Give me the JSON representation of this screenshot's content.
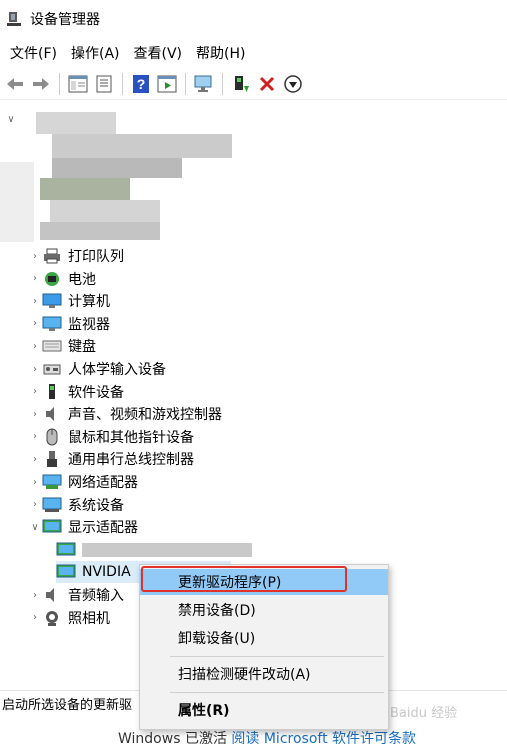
{
  "window": {
    "title": "设备管理器"
  },
  "menubar": {
    "items": [
      "文件(F)",
      "操作(A)",
      "查看(V)",
      "帮助(H)"
    ]
  },
  "toolbar": {
    "buttons": [
      "back-arrow-icon",
      "forward-arrow-icon",
      "view-tree-icon",
      "properties-sheet-icon",
      "help-icon",
      "run-icon",
      "monitor-scan-icon",
      "update-driver-icon",
      "uninstall-x-icon",
      "download-icon"
    ]
  },
  "tree": {
    "categories": [
      {
        "label": "打印队列",
        "icon": "printer-icon",
        "expanded": false
      },
      {
        "label": "电池",
        "icon": "battery-icon",
        "expanded": false
      },
      {
        "label": "计算机",
        "icon": "computer-icon",
        "expanded": false
      },
      {
        "label": "监视器",
        "icon": "monitor-icon",
        "expanded": false
      },
      {
        "label": "键盘",
        "icon": "keyboard-icon",
        "expanded": false
      },
      {
        "label": "人体学输入设备",
        "icon": "hid-icon",
        "expanded": false
      },
      {
        "label": "软件设备",
        "icon": "software-device-icon",
        "expanded": false
      },
      {
        "label": "声音、视频和游戏控制器",
        "icon": "speaker-icon",
        "expanded": false
      },
      {
        "label": "鼠标和其他指针设备",
        "icon": "mouse-icon",
        "expanded": false
      },
      {
        "label": "通用串行总线控制器",
        "icon": "usb-icon",
        "expanded": false
      },
      {
        "label": "网络适配器",
        "icon": "network-icon",
        "expanded": false
      },
      {
        "label": "系统设备",
        "icon": "system-device-icon",
        "expanded": false
      },
      {
        "label": "显示适配器",
        "icon": "display-adapter-icon",
        "expanded": true
      }
    ],
    "display_children": [
      "NVIDIA"
    ],
    "after": [
      {
        "label": "音频输入",
        "icon": "audio-input-icon"
      },
      {
        "label": "照相机",
        "icon": "camera-icon"
      }
    ]
  },
  "context_menu": {
    "items": [
      {
        "label": "更新驱动程序(P)",
        "highlighted": true,
        "bold": false
      },
      {
        "label": "禁用设备(D)",
        "highlighted": false,
        "bold": false
      },
      {
        "label": "卸载设备(U)",
        "highlighted": false,
        "bold": false
      },
      {
        "label": "扫描检测硬件改动(A)",
        "highlighted": false,
        "bold": false
      },
      {
        "label": "属性(R)",
        "highlighted": false,
        "bold": true
      }
    ],
    "highlight_border_color": "#e0322b",
    "highlight_fill_color": "#91c9f7"
  },
  "statusbar": {
    "text": "启动所选设备的更新驱"
  },
  "activation": {
    "prefix": "Windows 已激活",
    "link": "阅读 Microsoft 软件许可条款"
  },
  "watermark": "Baidu 经验"
}
